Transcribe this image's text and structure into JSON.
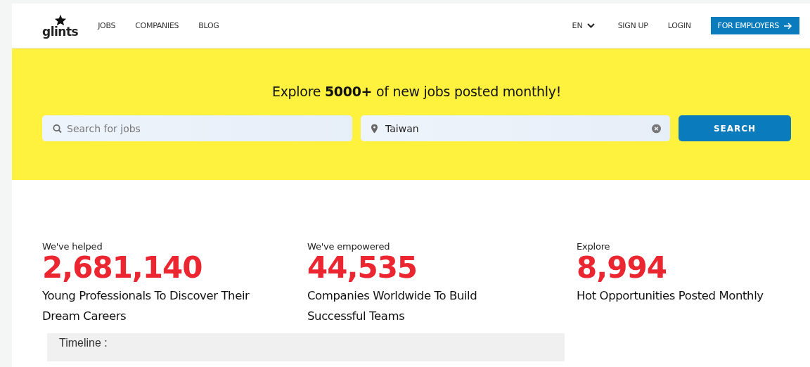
{
  "header": {
    "logo": "glints",
    "nav": [
      "JOBS",
      "COMPANIES",
      "BLOG"
    ],
    "language": "EN",
    "links": [
      "SIGN UP",
      "LOGIN"
    ],
    "employer_button": "FOR EMPLOYERS"
  },
  "hero": {
    "headline": "Explore **5000+** of new jobs posted monthly!",
    "search": {
      "placeholder": "Search for jobs"
    },
    "location": {
      "value": "Taiwan"
    },
    "button": "SEARCH"
  },
  "stats": [
    {
      "caption": "We've helped",
      "number": "2,681,140",
      "description": "Young Professionals To Discover Their Dream Careers"
    },
    {
      "caption": "We've empowered",
      "number": "44,535",
      "description": "Companies Worldwide To Build Successful Teams"
    },
    {
      "caption": "Explore",
      "number": "8,994",
      "description": "Hot Opportunities Posted Monthly"
    }
  ],
  "timeline": {
    "label": "Timeline :"
  }
}
